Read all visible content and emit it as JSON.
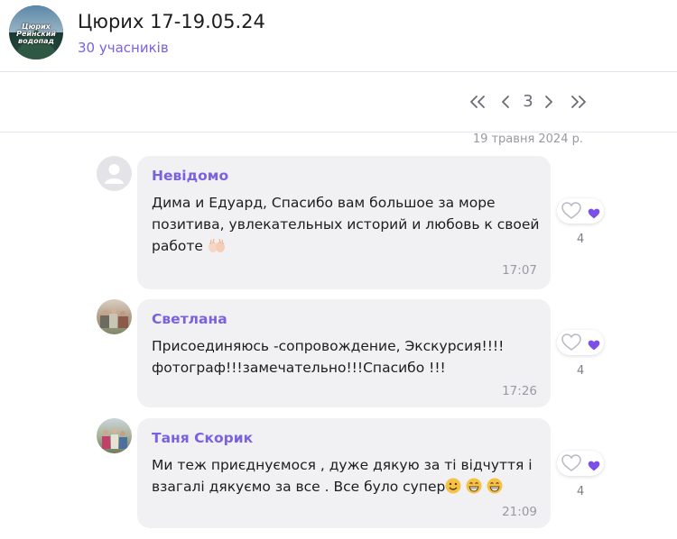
{
  "chat": {
    "title": "Цюрих 17-19.05.24",
    "participants": "30 учасників",
    "group_avatar_text": "Цюрих Рейнский водопад"
  },
  "pager": {
    "current_page": "3"
  },
  "date_separator": "19 травня 2024 р.",
  "messages": [
    {
      "author": "Невідомо",
      "text": "Дима и Едуард, Спасибо вам большое за море позитива, увлекательных историй и любовь к своей работе",
      "emoji": "palms-up-icon",
      "time": "17:07",
      "reactions": "4"
    },
    {
      "author": "Светлана",
      "text": "Присоединяюсь -сопровождение, Экскурсия!!!! фотограф!!!замечательно!!!Спасибо !!!",
      "time": "17:26",
      "reactions": "4"
    },
    {
      "author": "Таня Скорик",
      "text": "Ми теж приєднуємося , дуже дякую за ті відчуття і взагалі дякуємо за все . Все було супер",
      "emoji": "smile-icons",
      "time": "21:09",
      "reactions": "4"
    }
  ],
  "colors": {
    "accent": "#7b61e0",
    "bubble": "#f1f1f3",
    "muted": "#9a99a3"
  }
}
